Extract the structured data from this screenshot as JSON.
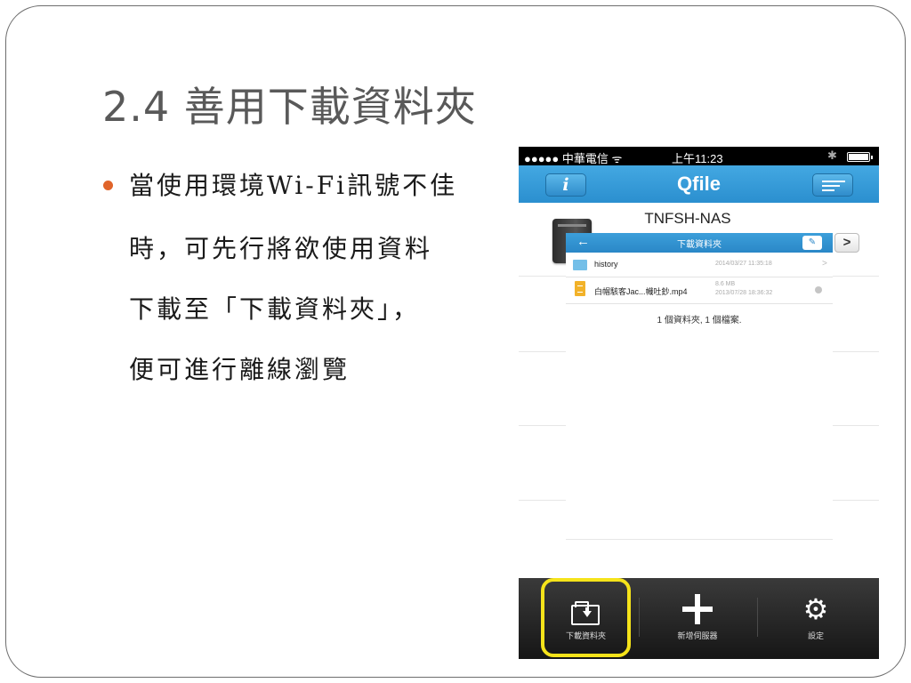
{
  "slide": {
    "title": "2.4 善用下載資料夾",
    "bullet_lines": [
      "當使用環境Wi-Fi訊號不佳",
      "時，可先行將欲使用資料",
      "下載至「下載資料夾」，",
      "便可進行離線瀏覽"
    ],
    "bullet_color": "#e0642a"
  },
  "phone": {
    "status_bar": {
      "carrier": "●●●●● 中華電信 ᯤ",
      "time": "上午11:23",
      "bluetooth": "✱"
    },
    "app_bar": {
      "info_label": "i",
      "title": "Qfile",
      "accent_color": "#2b8fcf"
    },
    "server": {
      "name": "TNFSH-NAS",
      "next_label": ">"
    },
    "panel": {
      "back_label": "←",
      "title": "下載資料夾",
      "edit_label": "✎"
    },
    "files": [
      {
        "name": "history",
        "date": "2014/03/27 11:35:18",
        "chevron": ">"
      },
      {
        "name": "白帽駭客Jac...幟吐鈔.mp4",
        "size": "8.6 MB",
        "date": "2013/07/28 18:36:32"
      }
    ],
    "summary": "1 個資料夾, 1 個檔案.",
    "tab_bar": {
      "tabs": [
        {
          "label": "下載資料夾",
          "icon": "folder-download-icon",
          "selected": true
        },
        {
          "label": "新增伺服器",
          "icon": "plus-icon"
        },
        {
          "label": "設定",
          "icon": "gear-icon"
        }
      ],
      "highlight_color": "#f5e31a"
    }
  }
}
